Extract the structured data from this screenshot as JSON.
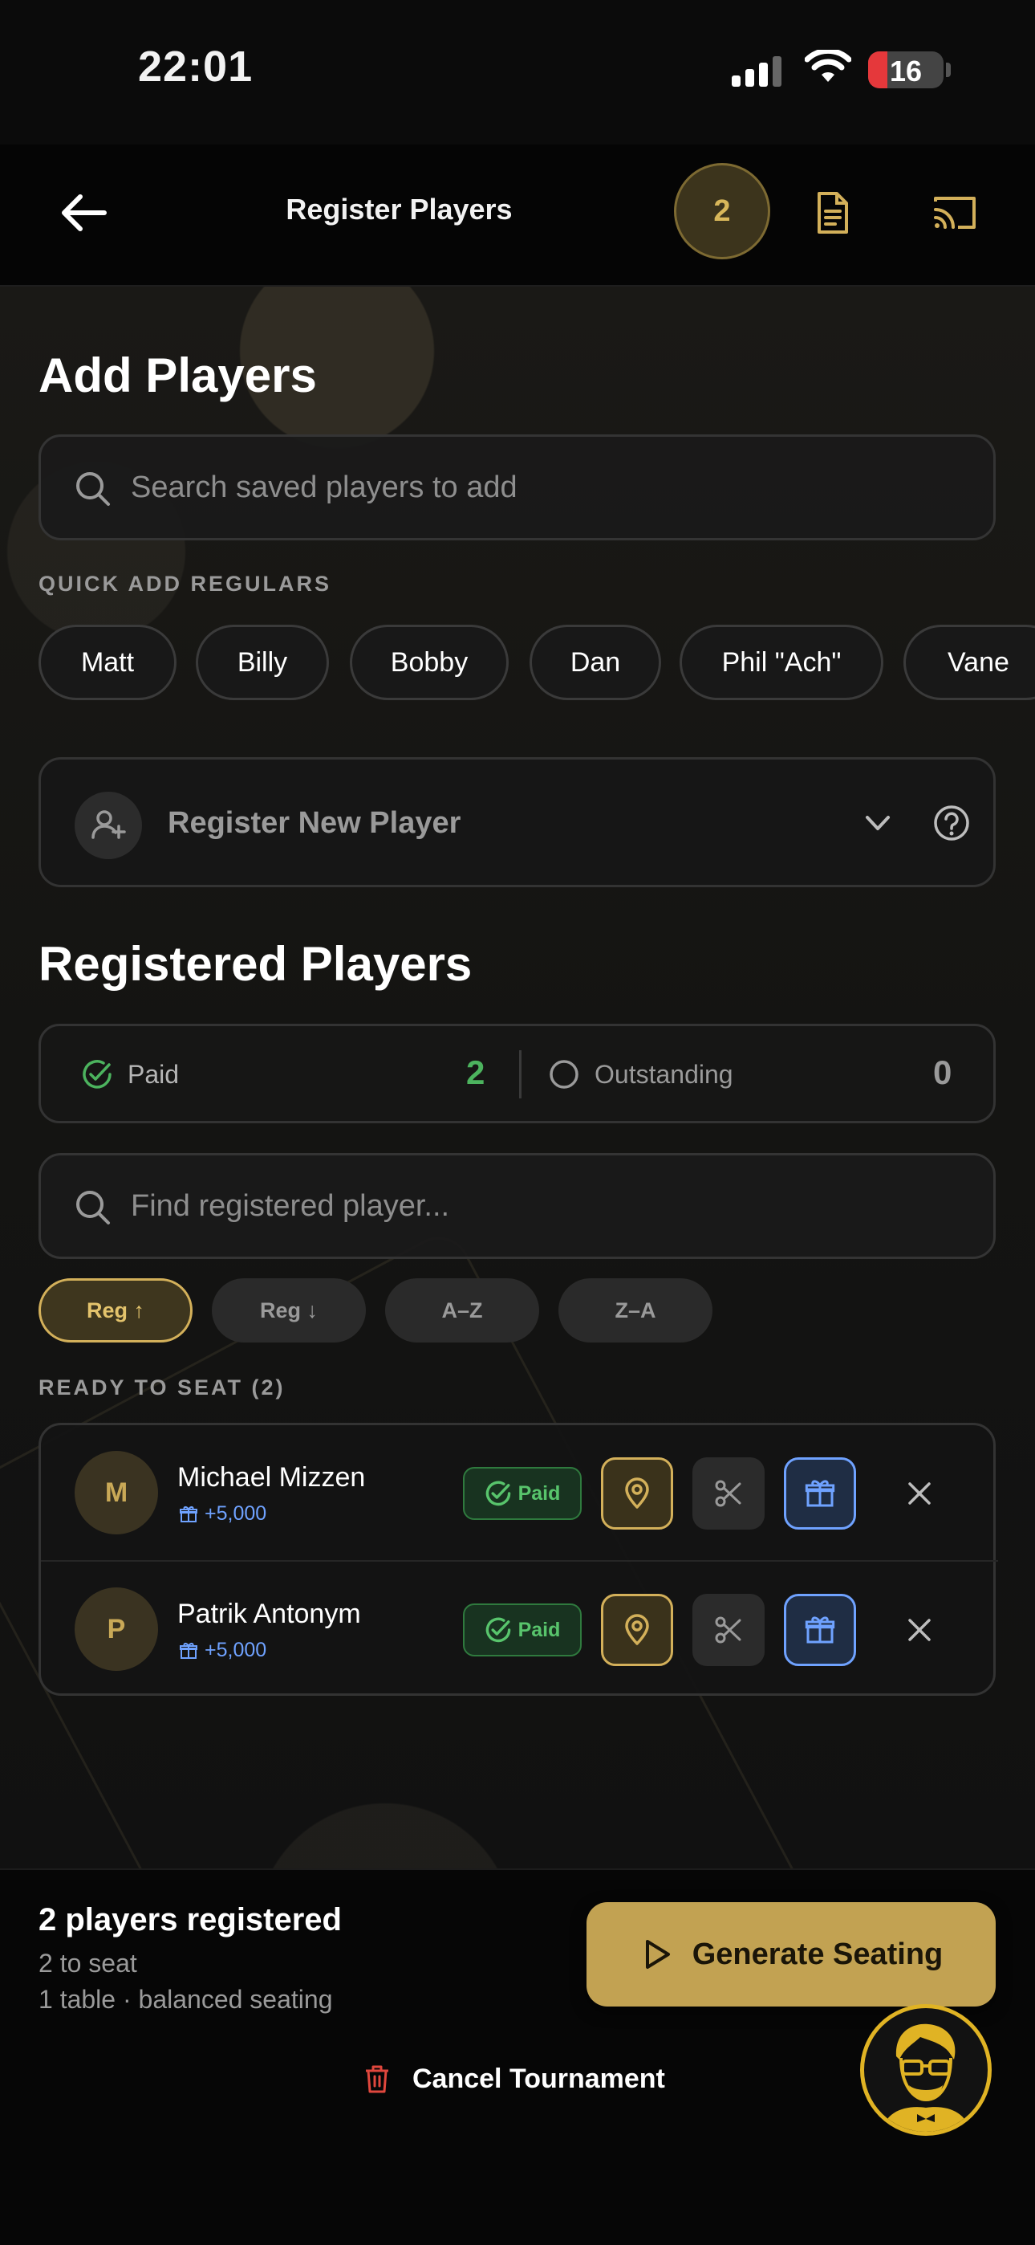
{
  "status_bar": {
    "time": "22:01",
    "battery": "16"
  },
  "nav": {
    "title": "Register Players",
    "count_badge": "2"
  },
  "add_players": {
    "heading": "Add Players",
    "search_placeholder": "Search saved players to add",
    "quick_add_label": "QUICK ADD REGULARS",
    "regulars": [
      "Matt",
      "Billy",
      "Bobby",
      "Dan",
      "Phil \"Ach\"",
      "Vane"
    ],
    "register_new_label": "Register New Player"
  },
  "registered": {
    "heading": "Registered Players",
    "paid_label": "Paid",
    "paid_count": "2",
    "outstanding_label": "Outstanding",
    "outstanding_count": "0",
    "search_placeholder": "Find registered player...",
    "sort_options": [
      "Reg ↑",
      "Reg ↓",
      "A–Z",
      "Z–A"
    ],
    "ready_label": "READY TO SEAT (2)",
    "players": [
      {
        "initial": "M",
        "name": "Michael Mizzen",
        "bonus": "+5,000",
        "status": "Paid"
      },
      {
        "initial": "P",
        "name": "Patrik Antonym",
        "bonus": "+5,000",
        "status": "Paid"
      }
    ]
  },
  "footer": {
    "title": "2 players registered",
    "subtitle1": "2 to seat",
    "subtitle2": "1 table · balanced seating",
    "generate_label": "Generate Seating",
    "cancel_label": "Cancel Tournament"
  },
  "colors": {
    "accent_gold": "#c2a252",
    "paid_green": "#4cb35e",
    "bonus_blue": "#6fa2ff"
  }
}
